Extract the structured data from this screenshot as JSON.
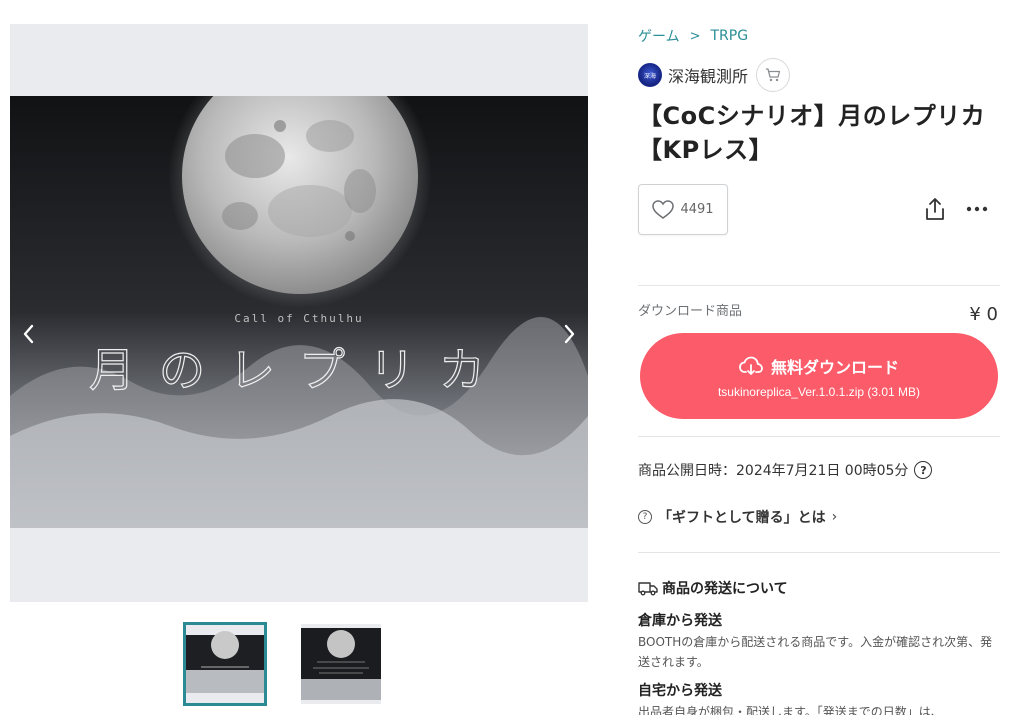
{
  "breadcrumb": {
    "category": "ゲーム",
    "sub": "TRPG",
    "separator": ">"
  },
  "shop": {
    "name": "深海観測所",
    "avatar_text": "深海"
  },
  "product": {
    "title": "【CoCシナリオ】月のレプリカ【KPレス】"
  },
  "gallery": {
    "art_caption": "Call of Cthulhu",
    "art_title": "月のレプリカ",
    "prev_icon": "chevron-left-icon",
    "next_icon": "chevron-right-icon",
    "thumbnail_count": 2,
    "active_thumbnail": 1
  },
  "likes": {
    "count": "4491",
    "icon": "heart-icon"
  },
  "actions": {
    "share_icon": "share-icon",
    "more_icon": "more-horizontal-icon"
  },
  "download": {
    "type_label": "ダウンロード商品",
    "price": "¥ 0",
    "button_label": "無料ダウンロード",
    "file_name": "tsukinoreplica_Ver.1.0.1.zip (3.01 MB)",
    "icon": "cloud-download-icon"
  },
  "published": {
    "text": "商品公開日時：2024年7月21日 00時05分",
    "help_icon": "?"
  },
  "gift": {
    "text": "「ギフトとして贈る」とは",
    "chevron": "›",
    "icon": "?"
  },
  "shipping": {
    "heading": "商品の発送について",
    "warehouse_title": "倉庫から発送",
    "warehouse_desc": "BOOTHの倉庫から配送される商品です。入金が確認され次第、発送されます。",
    "home_title": "自宅から発送",
    "home_desc": "出品者自身が梱包・配送します。「発送までの日数」は、"
  },
  "colors": {
    "accent": "#2a8f96",
    "download_button": "#fc5b6a",
    "gallery_bg": "#e9ebee",
    "thumb_active_border": "#2b8a93"
  }
}
